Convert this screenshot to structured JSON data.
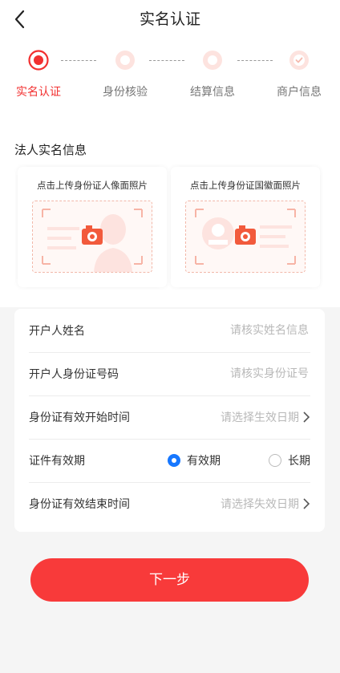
{
  "header": {
    "title": "实名认证"
  },
  "steps": [
    {
      "label": "实名认证",
      "state": "active"
    },
    {
      "label": "身份核验",
      "state": "pending"
    },
    {
      "label": "结算信息",
      "state": "pending"
    },
    {
      "label": "商户信息",
      "state": "pending"
    }
  ],
  "section": {
    "title": "法人实名信息"
  },
  "upload": {
    "front_caption": "点击上传身份证人像面照片",
    "back_caption": "点击上传身份证国徽面照片"
  },
  "form": {
    "name_label": "开户人姓名",
    "name_placeholder": "请核实姓名信息",
    "id_label": "开户人身份证号码",
    "id_placeholder": "请核实身份证号",
    "start_label": "身份证有效开始时间",
    "start_placeholder": "请选择生效日期",
    "validity_label": "证件有效期",
    "validity_options": [
      "有效期",
      "长期"
    ],
    "validity_selected": "有效期",
    "end_label": "身份证有效结束时间",
    "end_placeholder": "请选择失效日期"
  },
  "actions": {
    "next_label": "下一步"
  },
  "colors": {
    "accent": "#f23030",
    "button": "#f83a3a",
    "radio": "#1677ff"
  }
}
